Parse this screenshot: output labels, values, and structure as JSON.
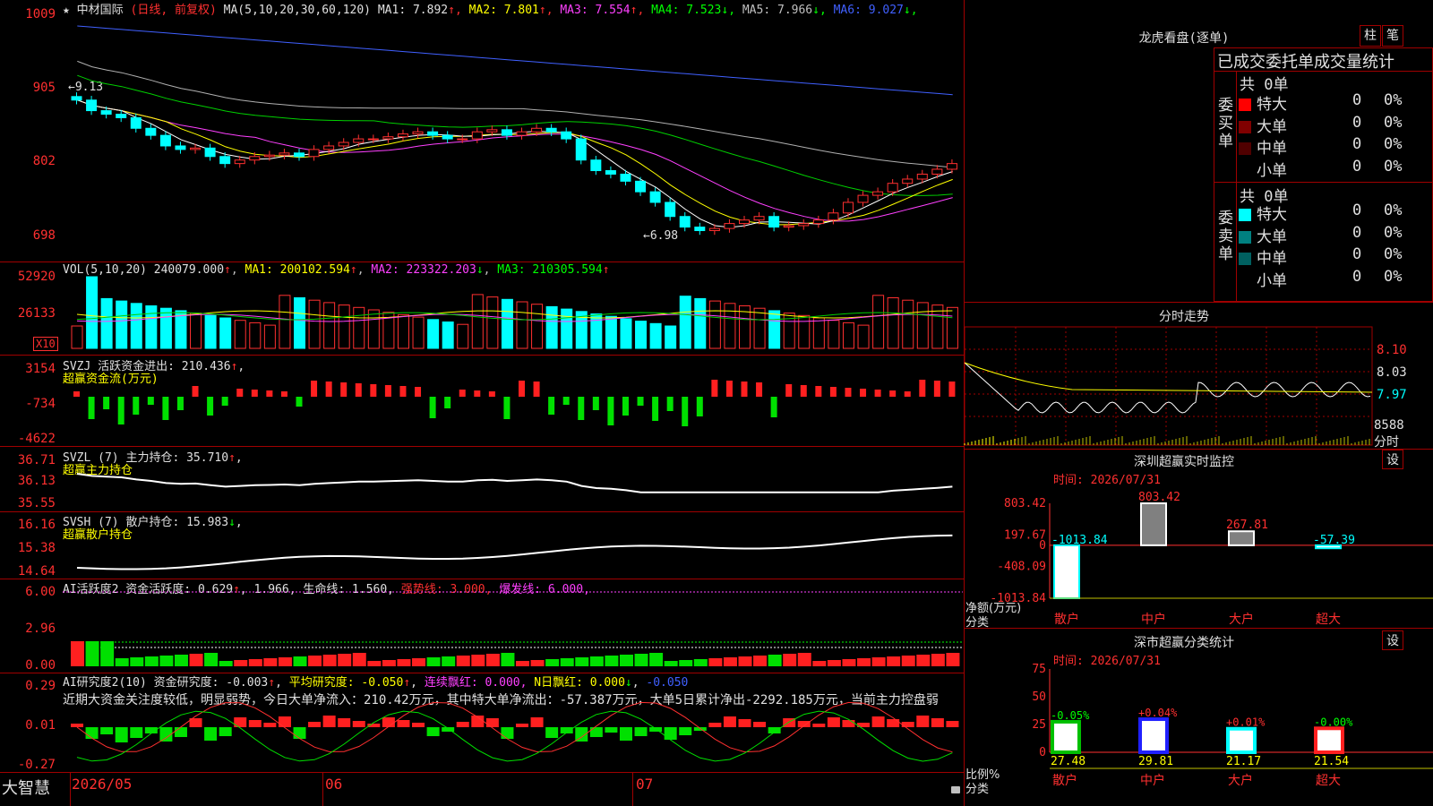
{
  "stock": {
    "name": "中材国际",
    "period": "(日线, 前复权)",
    "ma_header": "MA(5,10,20,30,60,120)",
    "ma": [
      {
        "label": "MA1:",
        "value": "7.892",
        "arrow": "↑",
        "color": "#e0e0e0"
      },
      {
        "label": "MA2:",
        "value": "7.801",
        "arrow": "↑",
        "color": "#ffff00"
      },
      {
        "label": "MA3:",
        "value": "7.554",
        "arrow": "↑",
        "color": "#ff40ff"
      },
      {
        "label": "MA4:",
        "value": "7.523",
        "arrow": "↓",
        "color": "#00ff00"
      },
      {
        "label": "MA5:",
        "value": "7.966",
        "arrow": "↓",
        "color": "#c0c0c0"
      },
      {
        "label": "MA6:",
        "value": "9.027",
        "arrow": "↓",
        "color": "#4060ff"
      }
    ],
    "price_axis": [
      "1009",
      "905",
      "802",
      "698"
    ],
    "high_label": "←9.13",
    "low_label": "←6.98"
  },
  "volume": {
    "header": "VOL(5,10,20)",
    "value": "240079.000",
    "ma1": "MA1: 200102.594",
    "ma2": "MA2: 223322.203",
    "ma3": "MA3: 210305.594",
    "axis": [
      "52920",
      "26133"
    ],
    "unit": "X10"
  },
  "svzj": {
    "header": "SVZJ  活跃资金进出: 210.436",
    "subtitle": "超赢资金流(万元)",
    "axis": [
      "3154",
      "-734",
      "-4622"
    ]
  },
  "svzl": {
    "header": "SVZL (7) 主力持仓: 35.710",
    "subtitle": "超赢主力持仓",
    "axis": [
      "36.71",
      "36.13",
      "35.55"
    ]
  },
  "svsh": {
    "header": "SVSH (7) 散户持仓: 15.983",
    "subtitle": "超赢散户持仓",
    "axis": [
      "16.16",
      "15.38",
      "14.64"
    ]
  },
  "ai_active": {
    "header": "AI活跃度2 资金活跃度: 0.629",
    "v2": "1.966",
    "life": "生命线: 1.560,",
    "strong": "强势线: 3.000,",
    "burst": "爆发线: 6.000,",
    "axis": [
      "6.00",
      "2.96",
      "0.00"
    ]
  },
  "ai_research": {
    "header": "AI研究度2(10) 资金研究度: -0.003",
    "avg": "平均研究度: -0.050",
    "red": "连续飘红: 0.000,",
    "nred": "N日飘红: 0.000",
    "nval": "-0.050",
    "comment": "近期大资金关注度较低，明显弱势，今日大单净流入：210.42万元，其中特大单净流出：-57.387万元，大单5日累计净出-2292.185万元，当前主力控盘弱",
    "axis": [
      "0.29",
      "0.01",
      "-0.27"
    ]
  },
  "footer": {
    "brand": "大智慧",
    "months": [
      "2026/05",
      "06",
      "07"
    ]
  },
  "right": {
    "dragon_title": "龙虎看盘(逐单)",
    "btn_zhu": "柱",
    "btn_bi": "笔",
    "stats_title": "已成交委托单成交量统计",
    "buy_label": "委买单",
    "sell_label": "委卖单",
    "buy_total": "共 0单",
    "sell_total": "共 0单",
    "buy_rows": [
      {
        "name": "特大",
        "count": "0",
        "pct": "0%",
        "color": "#ff0000"
      },
      {
        "name": "大单",
        "count": "0",
        "pct": "0%",
        "color": "#800000"
      },
      {
        "name": "中单",
        "count": "0",
        "pct": "0%",
        "color": "#500000"
      },
      {
        "name": "小单",
        "count": "0",
        "pct": "0%",
        "color": "#000000"
      }
    ],
    "sell_rows": [
      {
        "name": "特大",
        "count": "0",
        "pct": "0%",
        "color": "#00ffff"
      },
      {
        "name": "大单",
        "count": "0",
        "pct": "0%",
        "color": "#008080"
      },
      {
        "name": "中单",
        "count": "0",
        "pct": "0%",
        "color": "#006060"
      },
      {
        "name": "小单",
        "count": "0",
        "pct": "0%",
        "color": "#000000"
      }
    ],
    "intraday_title": "分时走势",
    "intraday_axis": [
      "8.10",
      "8.03",
      "7.97"
    ],
    "intraday_vol": "8588",
    "intraday_unit": "分时",
    "monitor_title": "深圳超赢实时监控",
    "monitor_time": "时间: 2026/07/31",
    "monitor_btn": "设",
    "monitor_axis": [
      "803.42",
      "197.67",
      "0",
      "-408.09",
      "-1013.84"
    ],
    "monitor_net": "净额(万元)",
    "monitor_cat": "分类",
    "classify_title": "深市超赢分类统计",
    "classify_time": "时间: 2026/07/31",
    "classify_btn": "设",
    "classify_axis": [
      "75",
      "50",
      "25",
      "0"
    ],
    "classify_ratio": "比例%",
    "classify_cat": "分类"
  },
  "chart_data": [
    {
      "type": "bar",
      "title": "深圳超赢实时监控",
      "categories": [
        "散户",
        "中户",
        "大户",
        "超大"
      ],
      "values": [
        -1013.84,
        803.42,
        267.81,
        -57.39
      ],
      "labels": [
        "-1013.84",
        "803.42",
        "267.81",
        "-57.39"
      ],
      "ylim": [
        -1013.84,
        803.42
      ]
    },
    {
      "type": "bar",
      "title": "深市超赢分类统计",
      "categories": [
        "散户",
        "中户",
        "大户",
        "超大"
      ],
      "values": [
        27.48,
        29.81,
        21.17,
        21.54
      ],
      "changes": [
        "-0.05%",
        "+0.04%",
        "+0.01%",
        "-0.00%"
      ],
      "labels": [
        "27.48",
        "29.81",
        "21.17",
        "21.54"
      ],
      "ylim": [
        0,
        75
      ]
    }
  ]
}
